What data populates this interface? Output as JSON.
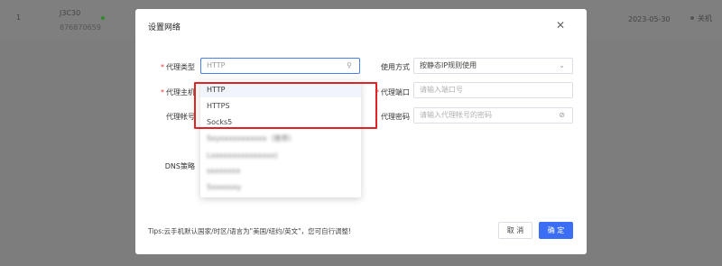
{
  "background_row": {
    "index": "1",
    "name": "J3C30",
    "id": "876870659",
    "date": "2023-05-30",
    "status": "关机"
  },
  "modal": {
    "title": "设置网络",
    "close_icon": "close-icon",
    "fields": {
      "proxy_type": {
        "label": "代理类型",
        "required": true,
        "value": "HTTP",
        "icon": "search-icon"
      },
      "proxy_host": {
        "label": "代理主机",
        "required": true
      },
      "proxy_account": {
        "label": "代理帐号",
        "required": false
      },
      "dns_policy": {
        "label": "DNS策略"
      },
      "usage_mode": {
        "label": "使用方式",
        "value": "按静态IP规则使用",
        "icon": "chevron-down-icon"
      },
      "proxy_port": {
        "label": "代理端口",
        "required": true,
        "placeholder": "请输入端口号"
      },
      "proxy_password": {
        "label": "代理密码",
        "placeholder": "请输入代理帐号的密码",
        "icon": "eye-off-icon"
      }
    },
    "dropdown": {
      "options": [
        "HTTP",
        "HTTPS",
        "Socks5"
      ],
      "selected": "HTTP",
      "blurred_options": [
        "Sxyxxxxxxxxxxx（推荐）",
        "Lxxxxxxxxxxxxxxx)",
        "sxxxxxxx",
        "Sxxxxxxy"
      ]
    },
    "tips": "Tips:云手机默认国家/时区/语言为\"美国/纽约/英文\"，您可自行调整!",
    "buttons": {
      "cancel": "取 消",
      "ok": "确 定"
    }
  },
  "colors": {
    "primary": "#3b6ef5",
    "highlight": "#e02222",
    "required": "#e23c3c"
  }
}
